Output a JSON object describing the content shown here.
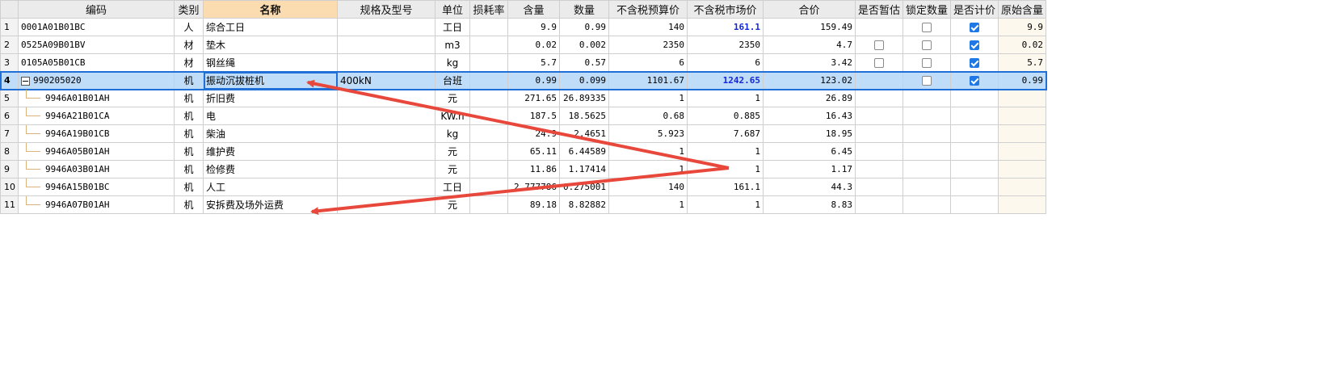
{
  "headers": [
    "",
    "编码",
    "类别",
    "名称",
    "规格及型号",
    "单位",
    "损耗率",
    "含量",
    "数量",
    "不含税预算价",
    "不含税市场价",
    "合价",
    "是否暂估",
    "锁定数量",
    "是否计价",
    "原始含量"
  ],
  "rows": [
    {
      "no": "1",
      "code": "0001A01B01BC",
      "type": "人",
      "name": "综合工日",
      "spec": "",
      "unit": "工日",
      "loss": "",
      "content": "9.9",
      "qty": "0.99",
      "budget": "140",
      "market": "161.1",
      "total": "159.49",
      "est": null,
      "lock": false,
      "price": true,
      "orig": "9.9"
    },
    {
      "no": "2",
      "code": "0525A09B01BV",
      "type": "材",
      "name": "垫木",
      "spec": "",
      "unit": "m3",
      "loss": "",
      "content": "0.02",
      "qty": "0.002",
      "budget": "2350",
      "market": "2350",
      "total": "4.7",
      "est": false,
      "lock": false,
      "price": true,
      "orig": "0.02"
    },
    {
      "no": "3",
      "code": "0105A05B01CB",
      "type": "材",
      "name": "钢丝绳",
      "spec": "",
      "unit": "kg",
      "loss": "",
      "content": "5.7",
      "qty": "0.57",
      "budget": "6",
      "market": "6",
      "total": "3.42",
      "est": false,
      "lock": false,
      "price": true,
      "orig": "5.7"
    },
    {
      "no": "4",
      "code": "990205020",
      "type": "机",
      "name": "振动沉拔桩机",
      "spec": "400kN",
      "unit": "台班",
      "loss": "",
      "content": "0.99",
      "qty": "0.099",
      "budget": "1101.67",
      "market": "1242.65",
      "total": "123.02",
      "est": null,
      "lock": false,
      "price": true,
      "orig": "0.99"
    },
    {
      "no": "5",
      "code": "9946A01B01AH",
      "type": "机",
      "name": "折旧费",
      "spec": "",
      "unit": "元",
      "loss": "",
      "content": "271.65",
      "qty": "26.89335",
      "budget": "1",
      "market": "1",
      "total": "26.89",
      "est": null,
      "lock": null,
      "price": null,
      "orig": ""
    },
    {
      "no": "6",
      "code": "9946A21B01CA",
      "type": "机",
      "name": "电",
      "spec": "",
      "unit": "KW.h",
      "loss": "",
      "content": "187.5",
      "qty": "18.5625",
      "budget": "0.68",
      "market": "0.885",
      "total": "16.43",
      "est": null,
      "lock": null,
      "price": null,
      "orig": ""
    },
    {
      "no": "7",
      "code": "9946A19B01CB",
      "type": "机",
      "name": "柴油",
      "spec": "",
      "unit": "kg",
      "loss": "",
      "content": "24.9",
      "qty": "2.4651",
      "budget": "5.923",
      "market": "7.687",
      "total": "18.95",
      "est": null,
      "lock": null,
      "price": null,
      "orig": ""
    },
    {
      "no": "8",
      "code": "9946A05B01AH",
      "type": "机",
      "name": "维护费",
      "spec": "",
      "unit": "元",
      "loss": "",
      "content": "65.11",
      "qty": "6.44589",
      "budget": "1",
      "market": "1",
      "total": "6.45",
      "est": null,
      "lock": null,
      "price": null,
      "orig": ""
    },
    {
      "no": "9",
      "code": "9946A03B01AH",
      "type": "机",
      "name": "检修费",
      "spec": "",
      "unit": "元",
      "loss": "",
      "content": "11.86",
      "qty": "1.17414",
      "budget": "1",
      "market": "1",
      "total": "1.17",
      "est": null,
      "lock": null,
      "price": null,
      "orig": ""
    },
    {
      "no": "10",
      "code": "9946A15B01BC",
      "type": "机",
      "name": "人工",
      "spec": "",
      "unit": "工日",
      "loss": "",
      "content": "2.777786",
      "qty": "0.275001",
      "budget": "140",
      "market": "161.1",
      "total": "44.3",
      "est": null,
      "lock": null,
      "price": null,
      "orig": ""
    },
    {
      "no": "11",
      "code": "9946A07B01AH",
      "type": "机",
      "name": "安拆费及场外运费",
      "spec": "",
      "unit": "元",
      "loss": "",
      "content": "89.18",
      "qty": "8.82882",
      "budget": "1",
      "market": "1",
      "total": "8.83",
      "est": null,
      "lock": null,
      "price": null,
      "orig": ""
    }
  ],
  "selected_row": "4",
  "colors": {
    "arrow": "#e8483b",
    "selection": "#bfdcf8",
    "focus": "#1f6fd6",
    "market_highlight": "#1428d8"
  }
}
